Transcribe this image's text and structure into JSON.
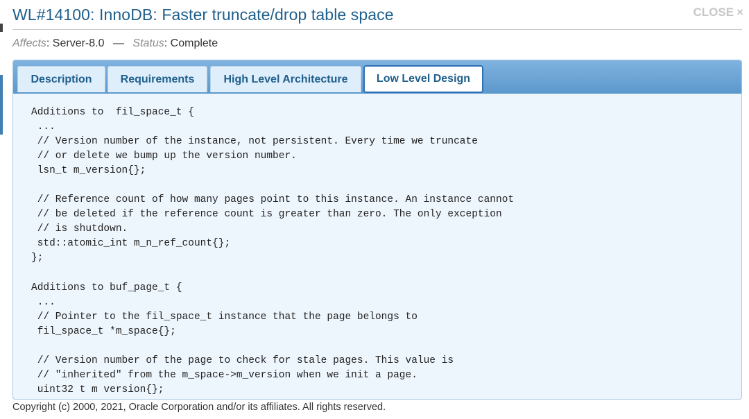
{
  "header": {
    "title": "WL#14100: InnoDB: Faster truncate/drop table space",
    "close_label": "CLOSE",
    "close_icon": "×"
  },
  "meta": {
    "affects_key": "Affects",
    "affects_value": ": Server-8.0",
    "separator": "—",
    "status_key": "Status",
    "status_value": ": Complete"
  },
  "tabs": [
    {
      "label": "Description",
      "active": false
    },
    {
      "label": "Requirements",
      "active": false
    },
    {
      "label": "High Level Architecture",
      "active": false
    },
    {
      "label": "Low Level Design",
      "active": true
    }
  ],
  "content": {
    "code_lines": [
      "Additions to  fil_space_t {",
      " ...",
      " // Version number of the instance, not persistent. Every time we truncate",
      " // or delete we bump up the version number.",
      " lsn_t m_version{};",
      "",
      " // Reference count of how many pages point to this instance. An instance cannot",
      " // be deleted if the reference count is greater than zero. The only exception",
      " // is shutdown.",
      " std::atomic_int m_n_ref_count{};",
      "};",
      "",
      "Additions to buf_page_t {",
      " ...",
      " // Pointer to the fil_space_t instance that the page belongs to",
      " fil_space_t *m_space{};",
      "",
      " // Version number of the page to check for stale pages. This value is",
      " // \"inherited\" from the m_space->m_version when we init a page.",
      " uint32 t m version{};"
    ]
  },
  "footer": {
    "copyright": "Copyright (c) 2000, 2021, Oracle Corporation and/or its affiliates. All rights reserved."
  }
}
